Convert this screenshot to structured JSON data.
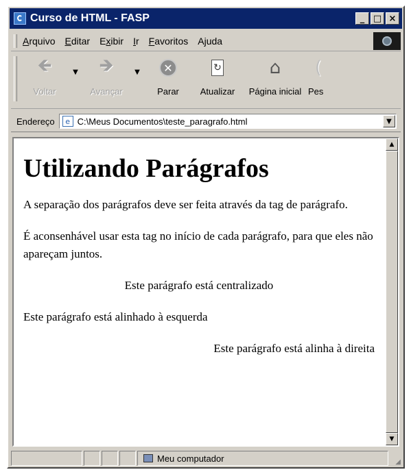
{
  "window": {
    "title": "Curso de HTML - FASP"
  },
  "title_buttons": {
    "minimize": "_",
    "maximize": "□",
    "close": "×"
  },
  "menu": {
    "items": [
      {
        "pre": "",
        "u": "A",
        "post": "rquivo"
      },
      {
        "pre": "",
        "u": "E",
        "post": "ditar"
      },
      {
        "pre": "E",
        "u": "x",
        "post": "ibir"
      },
      {
        "pre": "",
        "u": "I",
        "post": "r"
      },
      {
        "pre": "",
        "u": "F",
        "post": "avoritos"
      },
      {
        "pre": "A",
        "u": "j",
        "post": "uda"
      }
    ]
  },
  "toolbar": {
    "back": {
      "label": "Voltar",
      "icon": "back-arrow-icon"
    },
    "forward": {
      "label": "Avançar",
      "icon": "forward-arrow-icon"
    },
    "stop": {
      "label": "Parar",
      "icon": "stop-icon"
    },
    "refresh": {
      "label": "Atualizar",
      "icon": "refresh-icon"
    },
    "home": {
      "label": "Página inicial",
      "icon": "home-icon"
    },
    "search": {
      "label": "Pes",
      "icon": "search-icon"
    }
  },
  "address": {
    "label": "Endereço",
    "value": "C:\\Meus Documentos\\teste_paragrafo.html"
  },
  "page": {
    "heading": "Utilizando Parágrafos",
    "paragraphs": [
      "A separação dos parágrafos deve ser feita através da tag de parágrafo.",
      "É aconsenhável usar esta tag no início de cada parágrafo, para que eles não apareçam juntos.",
      "Este parágrafo está centralizado",
      "Este parágrafo está alinhado à esquerda",
      "Este parágrafo está alinha à direita"
    ]
  },
  "status": {
    "zone": "Meu computador"
  },
  "colors": {
    "titlebar": "#0a246a",
    "chrome": "#d4d0c8",
    "page_background": "#ffffff"
  }
}
